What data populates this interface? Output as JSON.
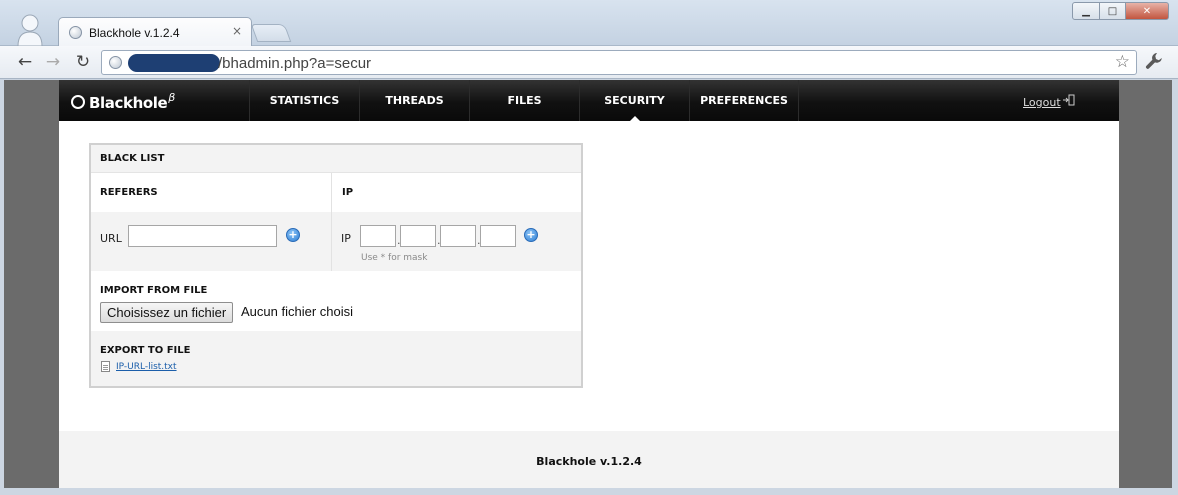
{
  "browser": {
    "tab_title": "Blackhole v.1.2.4",
    "tab_close": "×",
    "url_path": "/bhadmin.php?a=secur",
    "icons": [
      "avatar-icon",
      "globe-icon",
      "back-arrow-icon",
      "forward-arrow-icon",
      "reload-icon",
      "star-icon",
      "wrench-icon"
    ],
    "window_controls": {
      "minimize": "▁",
      "maximize": "□",
      "close": "✕"
    }
  },
  "header": {
    "logo_text": "Blackhole",
    "logo_sup": "β",
    "nav": [
      {
        "label": "STATISTICS",
        "active": false
      },
      {
        "label": "THREADS",
        "active": false
      },
      {
        "label": "FILES",
        "active": false
      },
      {
        "label": "SECURITY",
        "active": true
      },
      {
        "label": "PREFERENCES",
        "active": false
      }
    ],
    "logout_label": "Logout"
  },
  "blacklist": {
    "title": "BLACK LIST",
    "referers_heading": "REFERERS",
    "ip_heading": "IP",
    "url_label": "URL",
    "url_value": "",
    "ip_label": "IP",
    "ip_octets": [
      "",
      "",
      "",
      ""
    ],
    "ip_separator": ".",
    "mask_hint": "Use * for mask",
    "import_heading": "IMPORT FROM FILE",
    "choose_file_label": "Choisissez un fichier",
    "no_file_label": "Aucun fichier choisi",
    "export_heading": "EXPORT TO FILE",
    "export_file_link": "IP-URL-list.txt"
  },
  "footer": {
    "text": "Blackhole v.1.2.4"
  },
  "colors": {
    "header_bg": "#111111",
    "page_bg": "#6b6b6b",
    "row_alt": "#f3f3f3",
    "link": "#1b5eaa",
    "add_button": "#2f7fd4"
  }
}
